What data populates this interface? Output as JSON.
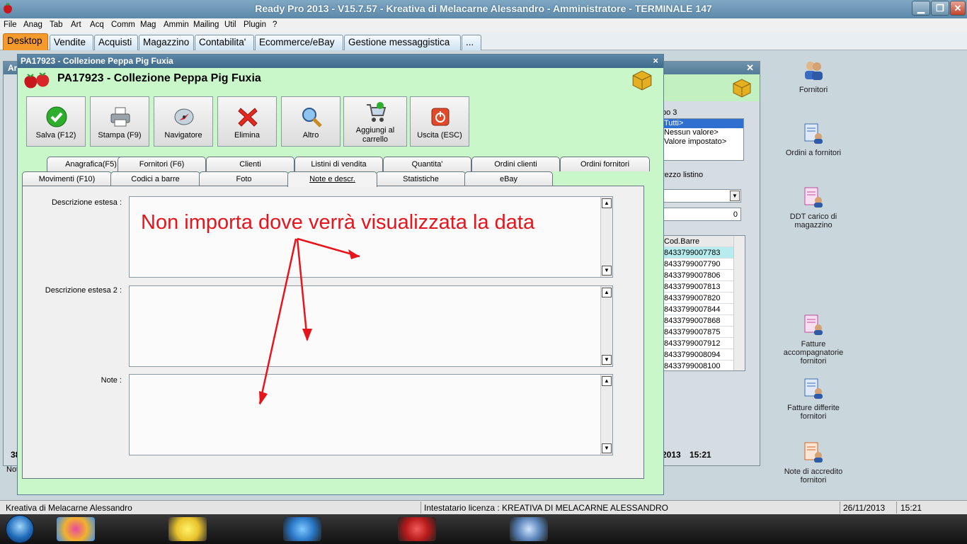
{
  "titlebar": {
    "title": "Ready Pro 2013 - V15.7.57 - Kreativa di Melacarne Alessandro - Amministratore - TERMINALE 147",
    "min": "▁",
    "max": "❐",
    "close": "✕"
  },
  "menu": [
    "File",
    "Anag",
    "Tab",
    "Art",
    "Acq",
    "Comm",
    "Mag",
    "Ammin",
    "Mailing",
    "Util",
    "Plugin",
    "?"
  ],
  "module_tabs": [
    "Desktop",
    "Vendite",
    "Acquisti",
    "Magazzino",
    "Contabilita'",
    "Ecommerce/eBay",
    "Gestione messaggistica",
    "..."
  ],
  "desktop_icons": [
    {
      "label": "Fornitori",
      "icon": "suppliers-icon"
    },
    {
      "label": "Ordini a fornitori",
      "icon": "supplier-orders-icon"
    },
    {
      "label": "DDT carico di magazzino",
      "icon": "warehouse-ddt-icon"
    },
    {
      "label": "Fatture accompagnatorie fornitori",
      "icon": "supplier-invoices-icon"
    },
    {
      "label": "Fatture differite fornitori",
      "icon": "deferred-invoices-icon"
    },
    {
      "label": "Note di accredito fornitori",
      "icon": "credit-notes-icon"
    }
  ],
  "background_window": {
    "title_prefix": "Ar",
    "group_label": "po 3",
    "filter_options": [
      "Tutti>",
      "Nessun valore>",
      "Valore impostato>"
    ],
    "price_label": "rezzo listino",
    "price_value": "0",
    "barcode_header": "Cod.Barre",
    "barcodes": [
      "8433799007783",
      "8433799007790",
      "8433799007806",
      "8433799007813",
      "8433799007820",
      "8433799007844",
      "8433799007868",
      "8433799007875",
      "8433799007912",
      "8433799008094",
      "8433799008100"
    ],
    "footer_left": "38",
    "footer_year": "2013",
    "footer_time": "15:21",
    "footer_note": "Not"
  },
  "dialog": {
    "header": "PA17923 - Collezione Peppa Pig Fuxia",
    "title": "PA17923 - Collezione Peppa Pig Fuxia",
    "close": "×",
    "toolbar": [
      {
        "label": "Salva (F12)",
        "icon": "save-check-icon"
      },
      {
        "label": "Stampa (F9)",
        "icon": "printer-icon"
      },
      {
        "label": "Navigatore",
        "icon": "navigator-icon"
      },
      {
        "label": "Elimina",
        "icon": "delete-x-icon"
      },
      {
        "label": "Altro",
        "icon": "search-magnifier-icon"
      },
      {
        "label": "Aggiungi al carrello",
        "icon": "cart-add-icon"
      },
      {
        "label": "Uscita (ESC)",
        "icon": "exit-power-icon"
      }
    ],
    "tabs_row1": [
      "Anagrafica(F5)",
      "Fornitori (F6)",
      "Clienti",
      "Listini di vendita",
      "Quantita'",
      "Ordini clienti",
      "Ordini fornitori"
    ],
    "tabs_row2": [
      "Movimenti (F10)",
      "Codici a barre",
      "Foto",
      "Note e descr.",
      "Statistiche",
      "eBay"
    ],
    "active_tab": "Note e descr.",
    "fields": [
      {
        "label": "Descrizione estesa :",
        "value": ""
      },
      {
        "label": "Descrizione estesa 2 :",
        "value": ""
      },
      {
        "label": "Note :",
        "value": ""
      }
    ]
  },
  "annotation": {
    "text": "Non importa dove verrà visualizzata la data",
    "color": "#e8141c"
  },
  "statusbar": {
    "company": "Kreativa di Melacarne Alessandro",
    "license": "Intestatario licenza : KREATIVA DI MELACARNE ALESSANDRO",
    "date": "26/11/2013",
    "time": "15:21"
  },
  "colors": {
    "active_module_tab": "#f59a2c",
    "dialog_bg": "#c9f7c9",
    "titlebar": "#6f97b5"
  }
}
